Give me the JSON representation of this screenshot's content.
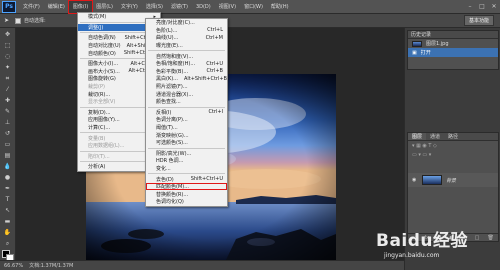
{
  "app": {
    "logo": "Ps"
  },
  "menubar": {
    "items": [
      "文件(F)",
      "编辑(E)",
      "图像(I)",
      "图层(L)",
      "文字(Y)",
      "选择(S)",
      "滤镜(T)",
      "3D(D)",
      "视图(V)",
      "窗口(W)",
      "帮助(H)"
    ],
    "active_index": 2
  },
  "options_bar": {
    "checkbox_label": "自动选择:",
    "workspace": "基本功能"
  },
  "status": {
    "zoom": "66.67%",
    "doc": "文档:1.37M/1.37M"
  },
  "image_menu": {
    "groups": [
      [
        {
          "label": "模式(M)",
          "shortcut": "",
          "arrow": true
        }
      ],
      [
        {
          "label": "调整(J)",
          "shortcut": "",
          "arrow": true,
          "highlighted": true
        }
      ],
      [
        {
          "label": "自动色调(N)",
          "shortcut": "Shift+Ctrl+L"
        },
        {
          "label": "自动对比度(U)",
          "shortcut": "Alt+Shift+Ctrl+L"
        },
        {
          "label": "自动颜色(O)",
          "shortcut": "Shift+Ctrl+B"
        }
      ],
      [
        {
          "label": "图像大小(I)...",
          "shortcut": "Alt+Ctrl+I"
        },
        {
          "label": "画布大小(S)...",
          "shortcut": "Alt+Ctrl+C"
        },
        {
          "label": "图像旋转(G)",
          "shortcut": "",
          "arrow": true
        },
        {
          "label": "裁剪(P)",
          "shortcut": "",
          "disabled": true
        },
        {
          "label": "裁切(R)...",
          "shortcut": ""
        },
        {
          "label": "显示全部(V)",
          "shortcut": "",
          "disabled": true
        }
      ],
      [
        {
          "label": "复制(D)...",
          "shortcut": ""
        },
        {
          "label": "应用图像(Y)...",
          "shortcut": ""
        },
        {
          "label": "计算(C)...",
          "shortcut": ""
        }
      ],
      [
        {
          "label": "变量(B)",
          "shortcut": "",
          "arrow": true,
          "disabled": true
        },
        {
          "label": "应用数据组(L)...",
          "shortcut": "",
          "disabled": true
        }
      ],
      [
        {
          "label": "陷印(T)...",
          "shortcut": "",
          "disabled": true
        }
      ],
      [
        {
          "label": "分析(A)",
          "shortcut": "",
          "arrow": true
        }
      ]
    ]
  },
  "adjust_menu": {
    "groups": [
      [
        {
          "label": "亮度/对比度(C)...",
          "shortcut": ""
        },
        {
          "label": "色阶(L)...",
          "shortcut": "Ctrl+L"
        },
        {
          "label": "曲线(U)...",
          "shortcut": "Ctrl+M"
        },
        {
          "label": "曝光度(E)...",
          "shortcut": ""
        }
      ],
      [
        {
          "label": "自然饱和度(V)...",
          "shortcut": ""
        },
        {
          "label": "色相/饱和度(H)...",
          "shortcut": "Ctrl+U"
        },
        {
          "label": "色彩平衡(B)...",
          "shortcut": "Ctrl+B"
        },
        {
          "label": "黑白(K)...",
          "shortcut": "Alt+Shift+Ctrl+B"
        },
        {
          "label": "照片滤镜(F)...",
          "shortcut": ""
        },
        {
          "label": "通道混合器(X)...",
          "shortcut": ""
        },
        {
          "label": "颜色查找...",
          "shortcut": ""
        }
      ],
      [
        {
          "label": "反相(I)",
          "shortcut": "Ctrl+I"
        },
        {
          "label": "色调分离(P)...",
          "shortcut": ""
        },
        {
          "label": "阈值(T)...",
          "shortcut": ""
        },
        {
          "label": "渐变映射(G)...",
          "shortcut": ""
        },
        {
          "label": "可选颜色(S)...",
          "shortcut": ""
        }
      ],
      [
        {
          "label": "阴影/高光(W)...",
          "shortcut": ""
        },
        {
          "label": "HDR 色调...",
          "shortcut": ""
        },
        {
          "label": "变化...",
          "shortcut": ""
        }
      ],
      [
        {
          "label": "去色(D)",
          "shortcut": "Shift+Ctrl+U"
        },
        {
          "label": "匹配颜色(M)...",
          "shortcut": "",
          "boxed": true
        },
        {
          "label": "替换颜色(R)...",
          "shortcut": ""
        },
        {
          "label": "色调均化(Q)",
          "shortcut": ""
        }
      ]
    ]
  },
  "history_panel": {
    "title": "历史记录",
    "rows": [
      "图层1.jpg",
      "打开"
    ]
  },
  "layers_panel": {
    "tabs": [
      "图层",
      "通道",
      "路径"
    ],
    "layer_name": "背景"
  },
  "watermark": {
    "brand": "Baidu经验",
    "url": "jingyan.baidu.com"
  }
}
